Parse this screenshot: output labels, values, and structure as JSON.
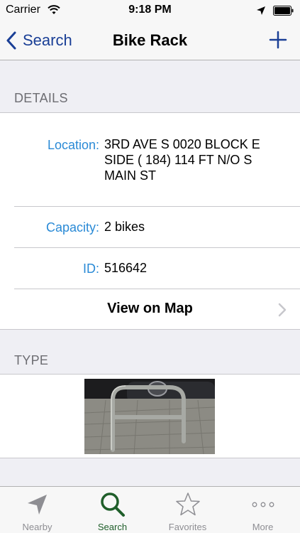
{
  "status_bar": {
    "carrier": "Carrier",
    "time": "9:18 PM"
  },
  "nav": {
    "back_label": "Search",
    "title": "Bike Rack"
  },
  "details": {
    "header": "DETAILS",
    "location_label": "Location:",
    "location_value": "3RD AVE S 0020 BLOCK E SIDE ( 184) 114 FT N/O S MAIN ST",
    "capacity_label": "Capacity:",
    "capacity_value": "2 bikes",
    "id_label": "ID:",
    "id_value": "516642",
    "map_label": "View on Map"
  },
  "type": {
    "header": "TYPE"
  },
  "tabs": [
    {
      "label": "Nearby",
      "icon": "location-arrow-icon",
      "active": false
    },
    {
      "label": "Search",
      "icon": "search-icon",
      "active": true
    },
    {
      "label": "Favorites",
      "icon": "star-icon",
      "active": false
    },
    {
      "label": "More",
      "icon": "more-icon",
      "active": false
    }
  ],
  "colors": {
    "nav_accent": "#1a3f96",
    "label_blue": "#2a8ad6",
    "tab_active": "#1f5e2a",
    "tab_inactive": "#8e8e93",
    "background": "#efeff4"
  }
}
